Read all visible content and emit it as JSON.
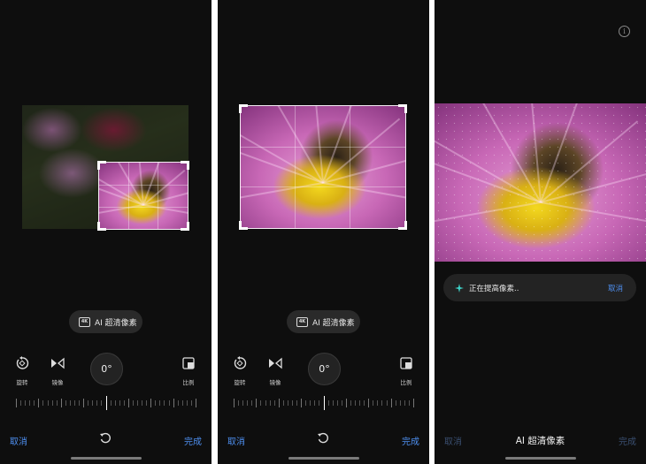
{
  "panels": [
    {
      "ai_pill": {
        "badge": "4K",
        "label": "AI 超清像素"
      },
      "tools": {
        "rotate": "旋转",
        "mirror": "镜像",
        "ratio": "比例"
      },
      "dial": "0°",
      "cancel": "取消",
      "done": "完成"
    },
    {
      "ai_pill": {
        "badge": "4K",
        "label": "AI 超清像素"
      },
      "tools": {
        "rotate": "旋转",
        "mirror": "镜像",
        "ratio": "比例"
      },
      "dial": "0°",
      "cancel": "取消",
      "done": "完成"
    },
    {
      "status": {
        "text": "正在提高像素..",
        "cancel": "取消"
      },
      "cancel": "取消",
      "title": "AI 超清像素",
      "done": "完成"
    }
  ],
  "icons": [
    "info-icon",
    "rotate-icon",
    "mirror-icon",
    "ratio-icon",
    "reset-icon",
    "sparkle-icon"
  ],
  "colors": {
    "background": "#0e0e0e",
    "accent": "#4e8ff0",
    "pill": "#2a2a2a"
  }
}
